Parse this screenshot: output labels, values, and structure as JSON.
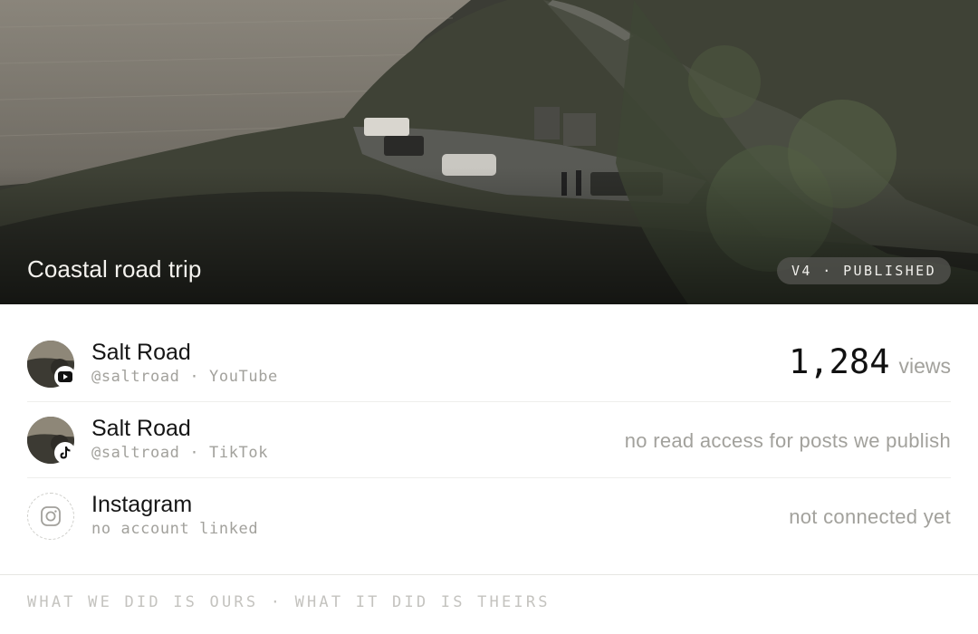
{
  "hero": {
    "title": "Coastal road trip",
    "badge": "V4 · PUBLISHED"
  },
  "accounts": [
    {
      "name": "Salt Road",
      "handle": "@saltroad",
      "platform": "YouTube",
      "subtitle": "@saltroad · YouTube",
      "icon": "youtube-icon",
      "views_value": "1,284",
      "views_label": "views"
    },
    {
      "name": "Salt Road",
      "handle": "@saltroad",
      "platform": "TikTok",
      "subtitle": "@saltroad · TikTok",
      "icon": "tiktok-icon",
      "note": "no read access for posts we publish"
    },
    {
      "name": "Instagram",
      "subtitle": "no account linked",
      "icon": "instagram-icon",
      "note": "not connected yet"
    }
  ],
  "footer": {
    "tagline": "WHAT WE DID IS OURS · WHAT IT DID IS THEIRS"
  }
}
